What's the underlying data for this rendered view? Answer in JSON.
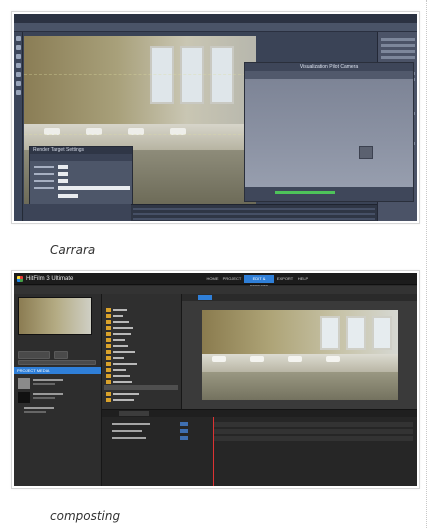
{
  "figures": [
    {
      "caption": "Carrara",
      "camera_window_title": "Visualization Pilot Camera",
      "dialog_title": "Render Target Settings"
    },
    {
      "caption": "composting",
      "app_title": "HitFilm 3 Ultimate",
      "nav_tabs": [
        "HOME",
        "PROJECT",
        "EDIT & EFFECTS",
        "EXPORT",
        "HELP"
      ],
      "active_nav_tab": "EDIT & EFFECTS",
      "media_panel_title": "PROJECT MEDIA"
    }
  ],
  "colors": {
    "hitfilm_accent": "#2f7fd8",
    "carrara_bg": "#3a4356",
    "hitfilm_bg": "#2a2a2a"
  }
}
